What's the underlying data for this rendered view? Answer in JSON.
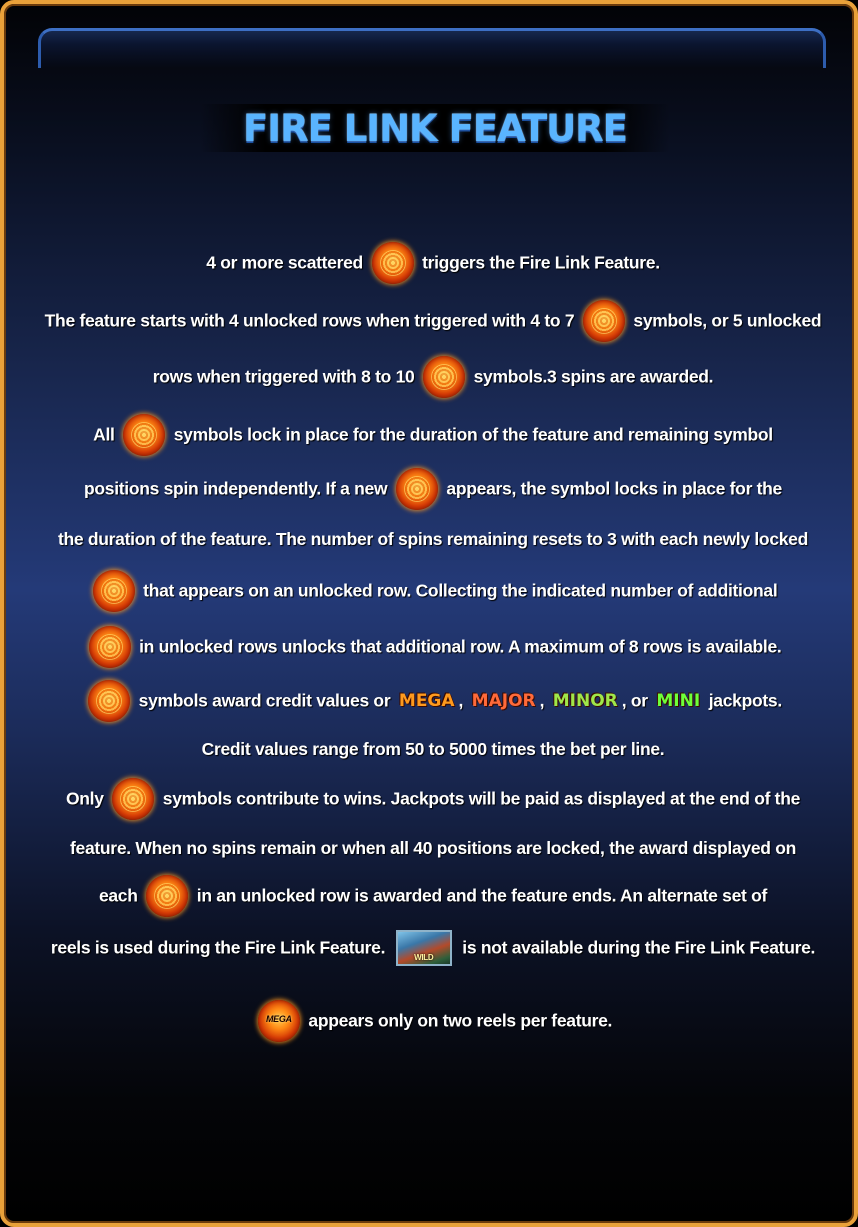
{
  "title": "FIRE LINK FEATURE",
  "lines": {
    "l1": {
      "a": "4 or more scattered",
      "b": "triggers the Fire Link Feature."
    },
    "l2": {
      "a": "The feature starts with 4 unlocked rows when triggered with 4 to 7",
      "b": "symbols, or 5 unlocked"
    },
    "l3": {
      "a": "rows when triggered with 8 to 10",
      "b": "symbols.3 spins are awarded."
    },
    "l4": {
      "a": "All",
      "b": "symbols lock in place for the duration of the feature and remaining symbol"
    },
    "l5": {
      "a": "positions spin independently. If a new",
      "b": "appears, the symbol locks in place for the"
    },
    "l6": {
      "a": "the duration of the feature. The number of spins remaining resets to 3 with each newly locked"
    },
    "l7": {
      "b": "that appears on an unlocked row. Collecting the indicated number of additional"
    },
    "l8": {
      "b": "in unlocked rows unlocks that additional row. A maximum of 8 rows is available."
    },
    "l9": {
      "a": "symbols award credit values or",
      "jp1": "MEGA",
      "sep1": ",",
      "jp2": "MAJOR",
      "sep2": ",",
      "jp3": "MINOR",
      "sep3": ", or",
      "jp4": "MINI",
      "b": "jackpots."
    },
    "l10": {
      "a": "Credit values range from 50 to 5000 times the bet per line."
    },
    "l11": {
      "a": "Only",
      "b": "symbols contribute to wins. Jackpots will be paid as displayed at the end of the"
    },
    "l12": {
      "a": "feature. When no spins remain or when all 40 positions are locked, the award displayed on"
    },
    "l13": {
      "a": "each",
      "b": "in an unlocked row is awarded and the feature ends. An alternate set of"
    },
    "l14": {
      "a": "reels is used during the Fire Link Feature.",
      "b": "is not available during the Fire Link Feature."
    },
    "l15": {
      "b": "appears only on two reels per feature."
    }
  },
  "icons": {
    "fireball": "fireball-icon",
    "mega_fireball_label": "MEGA",
    "wild_label": "WILD"
  },
  "colors": {
    "border": "#e9a13a",
    "title": "#59b4ff",
    "mega": "#ff9a1e",
    "major": "#ff6a3a",
    "minor": "#9fe74a",
    "mini": "#6dff3a"
  }
}
